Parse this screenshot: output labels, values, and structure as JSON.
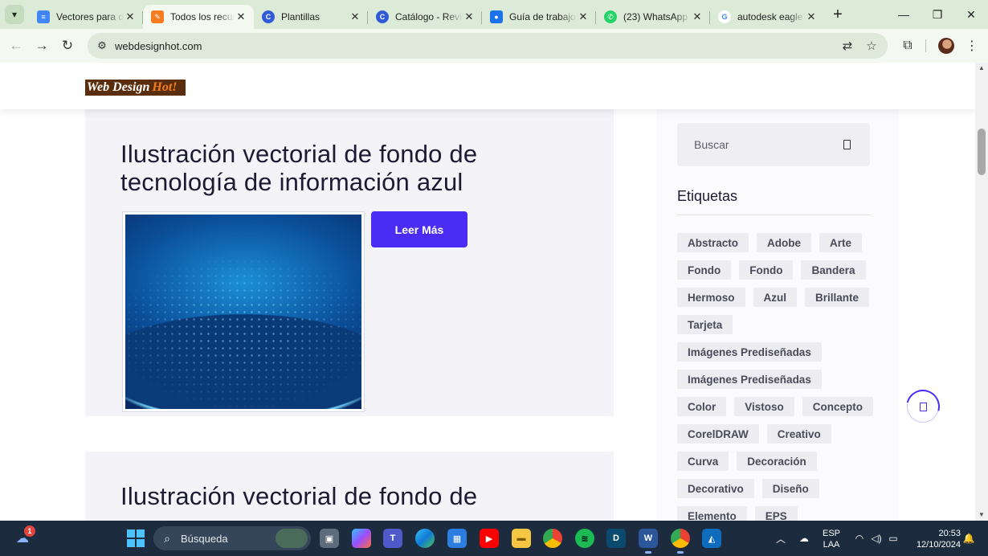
{
  "browser": {
    "tabs": [
      {
        "title": "Vectores para de",
        "icon": "docs-icon",
        "color": "#4285f4",
        "active": false
      },
      {
        "title": "Todos los recurs",
        "icon": "orange-site-icon",
        "color": "#f57c1f",
        "active": true
      },
      {
        "title": "Plantillas",
        "icon": "canva-icon",
        "color": "#2f5bd8",
        "active": false
      },
      {
        "title": "Catálogo - Revis",
        "icon": "canva-icon",
        "color": "#2f5bd8",
        "active": false
      },
      {
        "title": "Guía de trabajo",
        "icon": "classroom-icon",
        "color": "#1a73e8",
        "active": false
      },
      {
        "title": "(23) WhatsApp",
        "icon": "whatsapp-icon",
        "color": "#25d366",
        "active": false
      },
      {
        "title": "autodesk eagle",
        "icon": "google-icon",
        "color": "#ffffff",
        "active": false
      }
    ],
    "url": "webdesignhot.com"
  },
  "site": {
    "logo_part1": "Web Design",
    "logo_part2": "Hot!",
    "posts": [
      {
        "title": "Ilustración vectorial de fondo de tecnología de información azul",
        "button": "Leer Más"
      },
      {
        "title": "Ilustración vectorial de fondo de"
      }
    ],
    "search_placeholder": "Buscar",
    "tags_title": "Etiquetas",
    "tags": [
      "Abstracto",
      "Adobe",
      "Arte",
      "Fondo",
      "Fondo",
      "Bandera",
      "Hermoso",
      "Azul",
      "Brillante",
      "Tarjeta",
      "Imágenes Prediseñadas",
      "Imágenes Prediseñadas",
      "Color",
      "Vistoso",
      "Concepto",
      "CorelDRAW",
      "Creativo",
      "Curva",
      "Decoración",
      "Decorativo",
      "Diseño",
      "Elemento",
      "EPS"
    ]
  },
  "taskbar": {
    "search_label": "Búsqueda",
    "notification_count": "1",
    "lang_top": "ESP",
    "lang_bottom": "LAA",
    "time": "20:53",
    "date": "12/10/2024"
  },
  "colors": {
    "accent": "#4a2cf5",
    "chrome_bg": "#dcebd7",
    "taskbar_bg": "#1c2b3d"
  }
}
